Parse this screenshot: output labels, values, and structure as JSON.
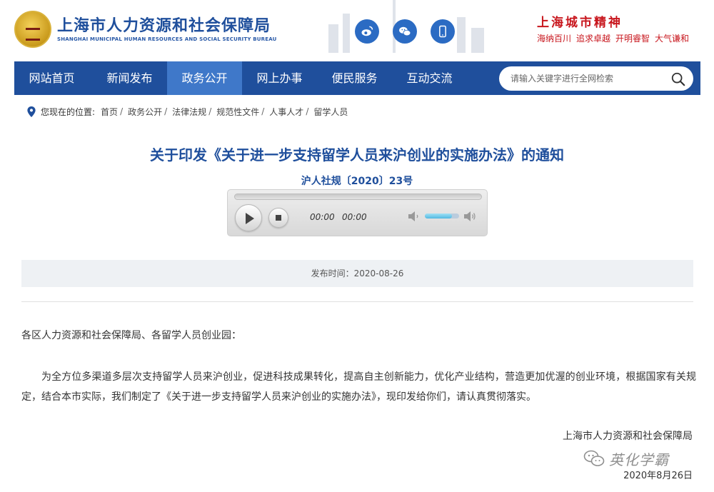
{
  "header": {
    "site_title": "上海市人力资源和社会保障局",
    "site_subtitle": "SHANGHAI MUNICIPAL HUMAN RESOURCES AND SOCIAL SECURITY BUREAU",
    "city_spirit_title": "上海城市精神",
    "city_spirit_motto": [
      "海纳百川",
      "追求卓越",
      "开明睿智",
      "大气谦和"
    ],
    "social_icons": [
      "weibo-icon",
      "wechat-icon",
      "mobile-icon"
    ]
  },
  "nav": {
    "items": [
      {
        "label": "网站首页",
        "active": false
      },
      {
        "label": "新闻发布",
        "active": false
      },
      {
        "label": "政务公开",
        "active": true
      },
      {
        "label": "网上办事",
        "active": false
      },
      {
        "label": "便民服务",
        "active": false
      },
      {
        "label": "互动交流",
        "active": false
      }
    ],
    "search_placeholder": "请输入关键字进行全网检索"
  },
  "breadcrumb": {
    "label": "您现在的位置:",
    "items": [
      "首页",
      "政务公开",
      "法律法规",
      "规范性文件",
      "人事人才",
      "留学人员"
    ]
  },
  "article": {
    "title": "关于印发《关于进一步支持留学人员来沪创业的实施办法》的通知",
    "doc_number": "沪人社规〔2020〕23号",
    "audio": {
      "current_time": "00:00",
      "duration": "00:00",
      "volume": 0.8
    },
    "publish_time": "发布时间：2020-08-26",
    "salutation": "各区人力资源和社会保障局、各留学人员创业园：",
    "body": "为全方位多渠道多层次支持留学人员来沪创业，促进科技成果转化，提高自主创新能力，优化产业结构，营造更加优渥的创业环境，根据国家有关规定，结合本市实际，我们制定了《关于进一步支持留学人员来沪创业的实施办法》，现印发给你们，请认真贯彻落实。",
    "signature_org": "上海市人力资源和社会保障局",
    "signature_date": "2020年8月26日"
  },
  "watermark": {
    "text": "英化学霸"
  },
  "colors": {
    "nav_blue": "#1f4f9c",
    "nav_active": "#3f78c9",
    "title_blue": "#1f4f9c",
    "spirit_red": "#c8161d"
  }
}
